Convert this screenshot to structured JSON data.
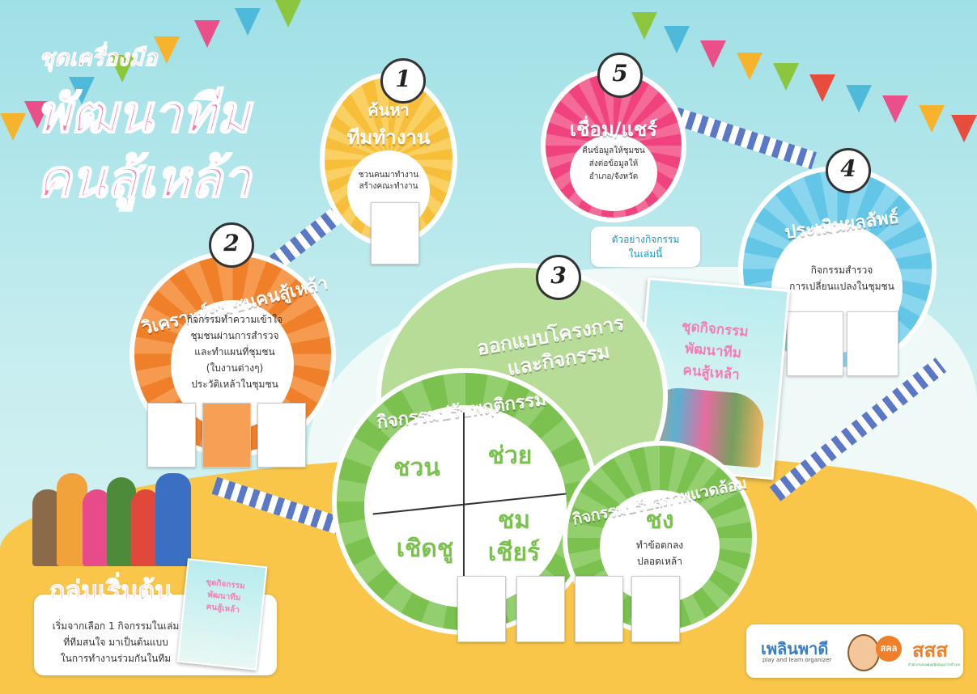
{
  "header": {
    "subtitle": "ชุดเครื่องมือ",
    "title_line1": "พัฒนาทีม",
    "title_line2": "คนสู้เหล้า"
  },
  "steps": [
    {
      "number": "1",
      "title_line1": "ค้นหา",
      "title_line2": "ทีมทำงาน",
      "text_line1": "ชวนคนมาทำงาน",
      "text_line2": "สร้างคณะทำงาน"
    },
    {
      "number": "2",
      "title": "วิเคราะห์ชุมชนคนสู้เหล้า",
      "text_line1": "กิจกรรมทำความเข้าใจ",
      "text_line2": "ชุมชนผ่านการสำรวจ",
      "text_line3": "และทำแผนที่ชุมชน",
      "text_line4": "(ใบงานต่างๆ)",
      "text_line5": "ประวัติเหล้าในชุมชน"
    },
    {
      "number": "3",
      "title_line1": "ออกแบบโครงการ",
      "title_line2": "และกิจกรรม"
    },
    {
      "number": "4",
      "title": "ประเมินผลลัพธ์",
      "text_line1": "กิจกรรมสำรวจ",
      "text_line2": "การเปลี่ยนแปลงในชุมชน"
    },
    {
      "number": "5",
      "title": "เชื่อม/แชร์",
      "text_line1": "คืนข้อมูลให้ชุมชน",
      "text_line2": "ส่งต่อข้อมูลให้",
      "text_line3": "อำเภอ/จังหวัด"
    }
  ],
  "behavior": {
    "title": "กิจกรรมปรับพฤติกรรม",
    "q1": "ชวน",
    "q2": "ช่วย",
    "q3": "เชิดชู",
    "q4_line1": "ชม",
    "q4_line2": "เชียร์"
  },
  "environment": {
    "title": "กิจกรรมปรับสภาพแวดล้อม",
    "big": "ชง",
    "text_line1": "ทำข้อตกลง",
    "text_line2": "ปลอดเหล้า"
  },
  "example": {
    "text_line1": "ตัวอย่างกิจกรรม",
    "text_line2": "ในเล่มนี้"
  },
  "book": {
    "line1": "ชุดกิจกรรม",
    "line2": "พัฒนาทีม",
    "line3": "คนสู้เหล้า"
  },
  "starter": {
    "title": "กลุ่มเริ่มต้น",
    "text_line1": "เริ่มจากเลือก 1 กิจกรรมในเล่ม",
    "text_line2": "ที่ทีมสนใจ มาเป็นต้นแบบ",
    "text_line3": "ในการทำงานร่วมกันในทีม"
  },
  "logos": {
    "plearn": "เพลินพาดี",
    "plearn_sub": "play and learn organizer",
    "sakhon": "สคล",
    "sss": "สสส",
    "sss_sub": "สำนักงานกองทุนสนับสนุนการสร้างเสริมสุขภาพ"
  },
  "colors": {
    "orange": "#f07f2a",
    "yellow": "#f7be3a",
    "pink": "#f0427e",
    "blue": "#63c6e6",
    "green": "#7ac14f",
    "title_pink": "#f05ca0"
  }
}
